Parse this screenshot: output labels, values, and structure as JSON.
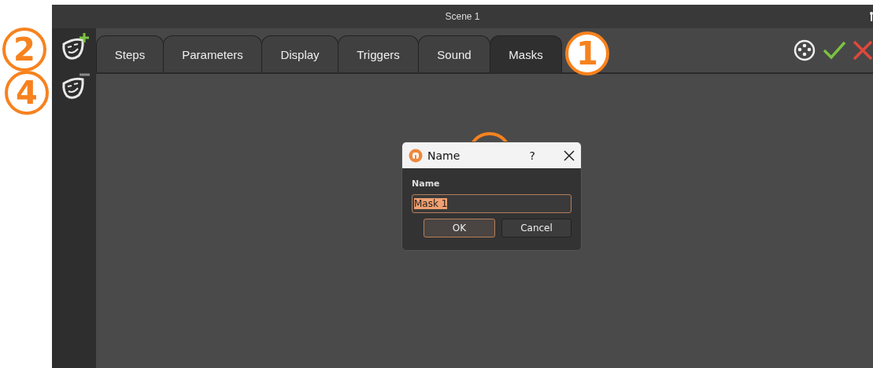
{
  "window": {
    "title": "Scene 1"
  },
  "sidebar": {
    "items": [
      {
        "kind": "add"
      },
      {
        "kind": "remove"
      }
    ]
  },
  "tabs": [
    {
      "label": "Steps",
      "selected": false
    },
    {
      "label": "Parameters",
      "selected": false
    },
    {
      "label": "Display",
      "selected": false
    },
    {
      "label": "Triggers",
      "selected": false
    },
    {
      "label": "Sound",
      "selected": false
    },
    {
      "label": "Masks",
      "selected": true
    }
  ],
  "toolbar_actions": [
    {
      "kind": "dmx"
    },
    {
      "kind": "confirm"
    },
    {
      "kind": "cancel"
    }
  ],
  "dialog": {
    "title": "Name",
    "help": "?",
    "field_label": "Name",
    "value": "Mask 1",
    "value_selected": true,
    "buttons": [
      {
        "label": "OK",
        "default": true
      },
      {
        "label": "Cancel",
        "default": false
      }
    ]
  },
  "callouts": [
    {
      "kind": "numbered",
      "number": "2"
    },
    {
      "kind": "numbered",
      "number": "4"
    },
    {
      "kind": "numbered",
      "number": "1"
    },
    {
      "kind": "covered"
    }
  ]
}
